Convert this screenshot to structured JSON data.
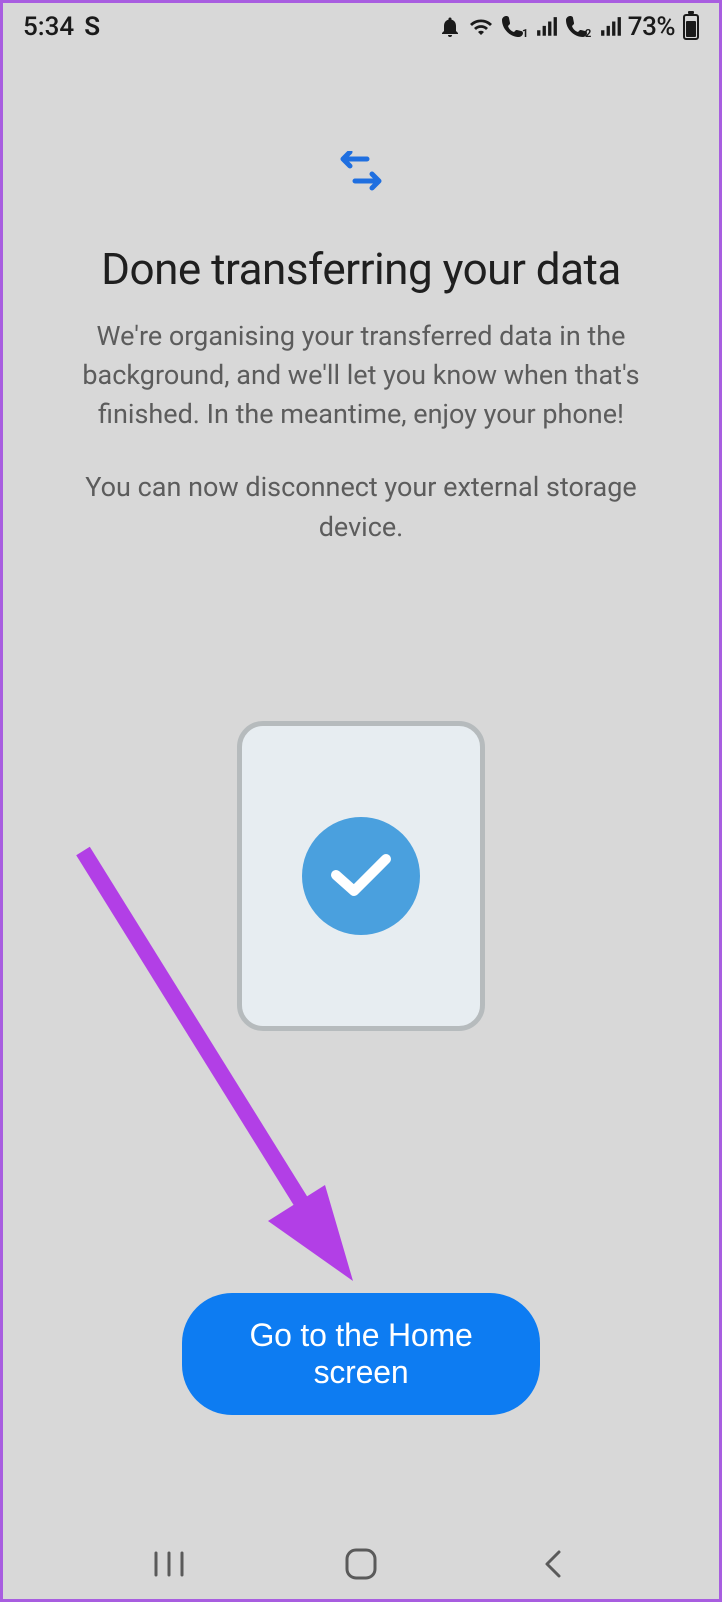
{
  "status": {
    "time": "5:34",
    "app_indicator": "S",
    "battery_pct": "73%"
  },
  "main": {
    "title": "Done transferring your data",
    "desc1": "We're organising your transferred data in the background, and we'll let you know when that's finished. In the meantime, enjoy your phone!",
    "desc2": "You can now disconnect your external storage device.",
    "button_label": "Go to the Home screen"
  }
}
